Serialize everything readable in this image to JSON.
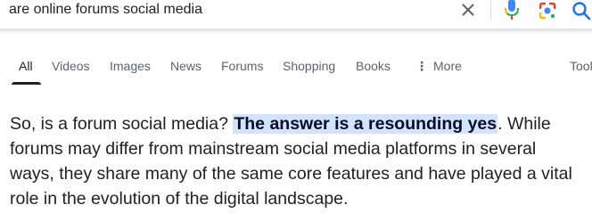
{
  "search": {
    "query": "are online forums social media",
    "icons": [
      "close-icon",
      "mic-icon",
      "google-lens-icon",
      "search-icon"
    ],
    "colors": {
      "mic_blue": "#4285f4",
      "mic_red": "#ea4335",
      "lens_blue": "#4285f4",
      "lens_red": "#ea4335",
      "lens_yellow": "#fbbc04",
      "lens_green": "#34a853",
      "search_blue": "#1a73e8"
    }
  },
  "tabs": [
    {
      "label": "All",
      "active": true
    },
    {
      "label": "Videos"
    },
    {
      "label": "Images"
    },
    {
      "label": "News"
    },
    {
      "label": "Forums"
    },
    {
      "label": "Shopping"
    },
    {
      "label": "Books"
    },
    {
      "label": "More",
      "icon": "more-vert-icon"
    },
    {
      "label": "Tools"
    }
  ],
  "answer": {
    "line1_before": "So, is a forum social media? ",
    "line1_highlight": "The answer is a resounding yes",
    "line1_after": ". While",
    "line2": "forums may differ from mainstream social media platforms in several",
    "line3": "ways, they share many of the same core features and have played a vital",
    "line4": "role in the evolution of the digital landscape.",
    "highlight_color": "#d3e3fd"
  }
}
